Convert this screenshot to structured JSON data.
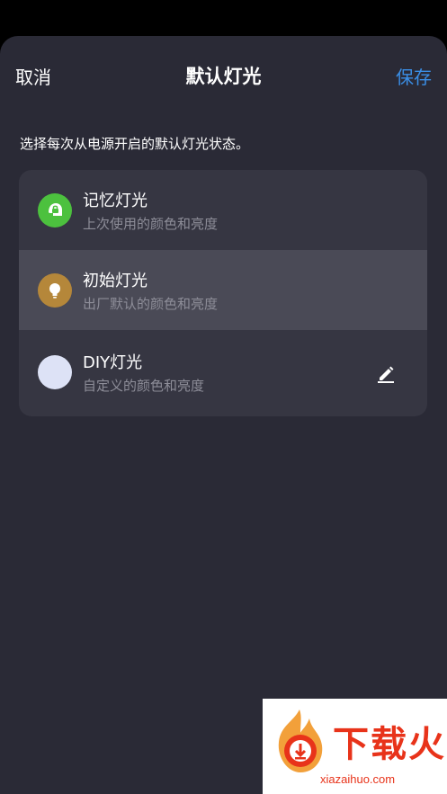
{
  "header": {
    "cancel_label": "取消",
    "title": "默认灯光",
    "save_label": "保存"
  },
  "description": "选择每次从电源开启的默认灯光状态。",
  "options": [
    {
      "title": "记忆灯光",
      "subtitle": "上次使用的颜色和亮度",
      "icon": "memory-icon",
      "icon_color": "#4cc13e",
      "selected": false
    },
    {
      "title": "初始灯光",
      "subtitle": "出厂默认的颜色和亮度",
      "icon": "lightbulb-icon",
      "icon_color": "#b5873a",
      "selected": true
    },
    {
      "title": "DIY灯光",
      "subtitle": "自定义的颜色和亮度",
      "icon": "color-swatch-icon",
      "icon_color": "#dde2f6",
      "selected": false
    }
  ],
  "watermark": {
    "text": "下载火",
    "url": "xiazaihuo.com"
  },
  "colors": {
    "accent": "#3a8ee6",
    "sheet_background": "#2a2a36",
    "card_background": "#363642",
    "selected_row": "#4a4a56"
  }
}
